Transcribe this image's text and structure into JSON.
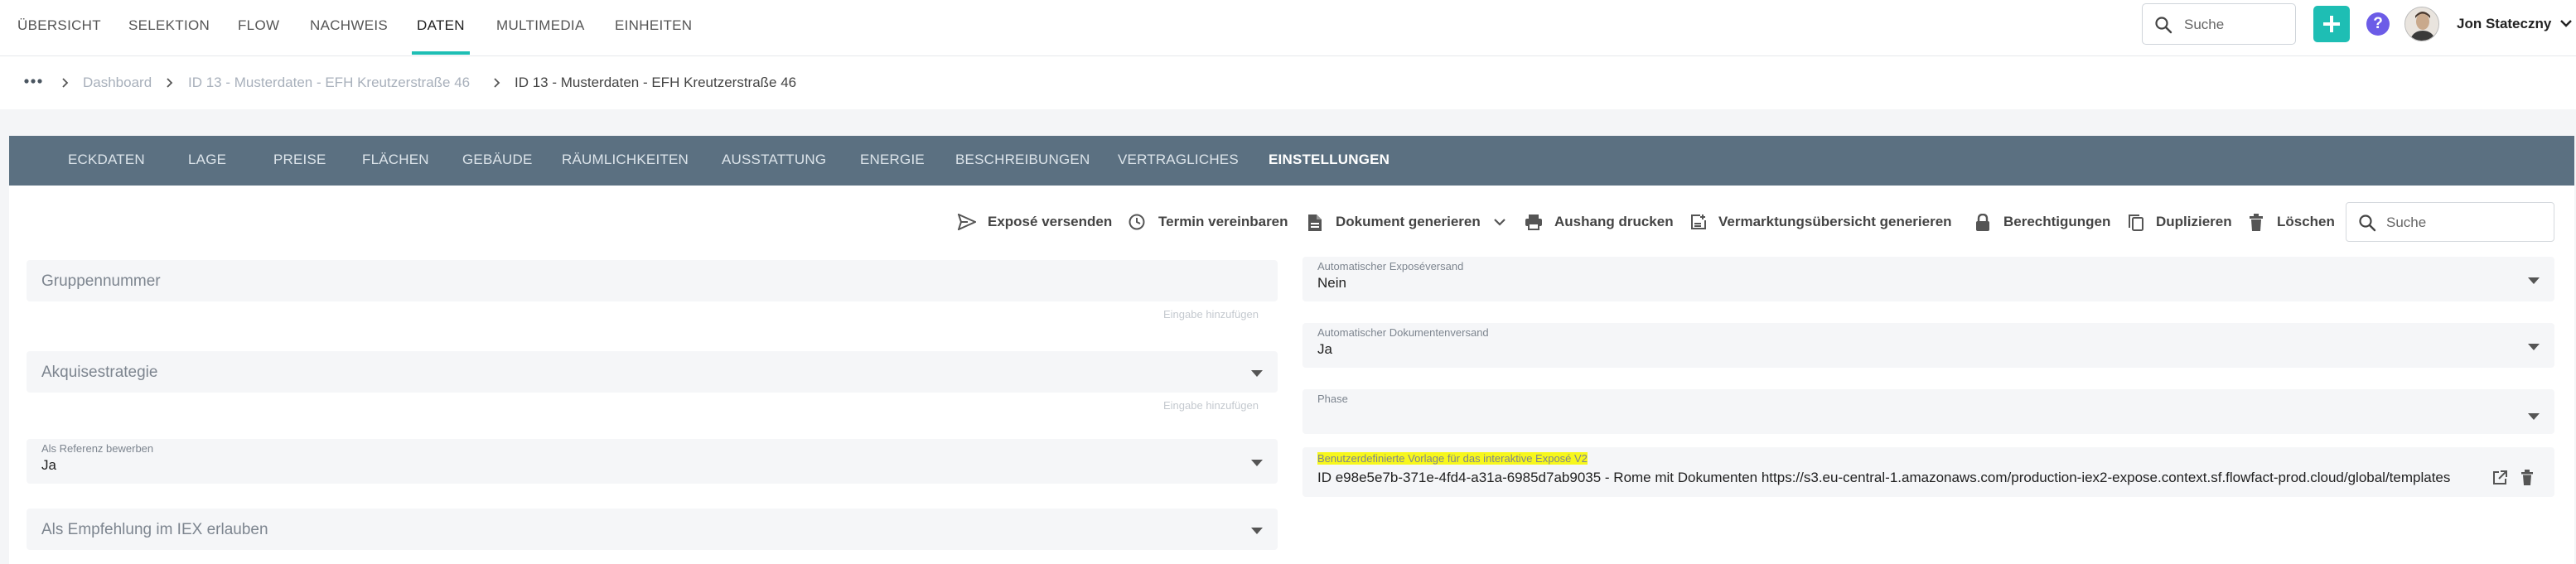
{
  "topnav": {
    "items": [
      {
        "label": "ÜBERSICHT",
        "active": false
      },
      {
        "label": "SELEKTION",
        "active": false
      },
      {
        "label": "FLOW",
        "active": false
      },
      {
        "label": "NACHWEIS",
        "active": false
      },
      {
        "label": "DATEN",
        "active": true
      },
      {
        "label": "MULTIMEDIA",
        "active": false
      },
      {
        "label": "EINHEITEN",
        "active": false
      }
    ],
    "search_placeholder": "Suche",
    "user_name": "Jon Stateczny",
    "accent_color": "#1ebeb4",
    "help_color": "#6c5ce7"
  },
  "breadcrumb": {
    "items": [
      {
        "label": "Dashboard"
      },
      {
        "label": "ID 13 - Musterdaten - EFH Kreutzerstraße 46"
      },
      {
        "label": "ID 13 - Musterdaten - EFH Kreutzerstraße 46"
      }
    ]
  },
  "tabs": [
    {
      "label": "ECKDATEN",
      "active": false
    },
    {
      "label": "LAGE",
      "active": false
    },
    {
      "label": "PREISE",
      "active": false
    },
    {
      "label": "FLÄCHEN",
      "active": false
    },
    {
      "label": "GEBÄUDE",
      "active": false
    },
    {
      "label": "RÄUMLICHKEITEN",
      "active": false
    },
    {
      "label": "AUSSTATTUNG",
      "active": false
    },
    {
      "label": "ENERGIE",
      "active": false
    },
    {
      "label": "BESCHREIBUNGEN",
      "active": false
    },
    {
      "label": "VERTRAGLICHES",
      "active": false
    },
    {
      "label": "EINSTELLUNGEN",
      "active": true
    }
  ],
  "actions": [
    {
      "label": "Exposé versenden",
      "icon": "send-icon"
    },
    {
      "label": "Termin vereinbaren",
      "icon": "clock-icon"
    },
    {
      "label": "Dokument generieren",
      "icon": "document-icon"
    },
    {
      "label": "Aushang drucken",
      "icon": "printer-icon"
    },
    {
      "label": "Vermarktungsübersicht generieren",
      "icon": "report-icon"
    },
    {
      "label": "Berechtigungen",
      "icon": "lock-icon"
    },
    {
      "label": "Duplizieren",
      "icon": "copy-icon"
    },
    {
      "label": "Löschen",
      "icon": "trash-icon"
    }
  ],
  "content_search_placeholder": "Suche",
  "left_fields": {
    "gruppennummer": {
      "placeholder": "Gruppennummer",
      "hint": "Eingabe hinzufügen"
    },
    "akquisestrategie": {
      "placeholder": "Akquisestrategie",
      "hint": "Eingabe hinzufügen"
    },
    "referenz": {
      "label": "Als Referenz bewerben",
      "value": "Ja"
    },
    "empfehlung": {
      "placeholder": "Als Empfehlung im IEX erlauben"
    }
  },
  "right_fields": {
    "expose_versand": {
      "label": "Automatischer Exposéversand",
      "value": "Nein"
    },
    "dokumenten_versand": {
      "label": "Automatischer Dokumentenversand",
      "value": "Ja"
    },
    "phase": {
      "label": "Phase",
      "value": ""
    },
    "vorlage": {
      "label": "Benutzerdefinierte Vorlage für das interaktive Exposé V2",
      "value": "ID e98e5e7b-371e-4fd4-a31a-6985d7ab9035 - Rome mit Dokumenten https://s3.eu-central-1.amazonaws.com/production-iex2-expose.context.sf.flowfact-prod.cloud/global/templates",
      "highlight_color": "#f7f71c"
    }
  }
}
